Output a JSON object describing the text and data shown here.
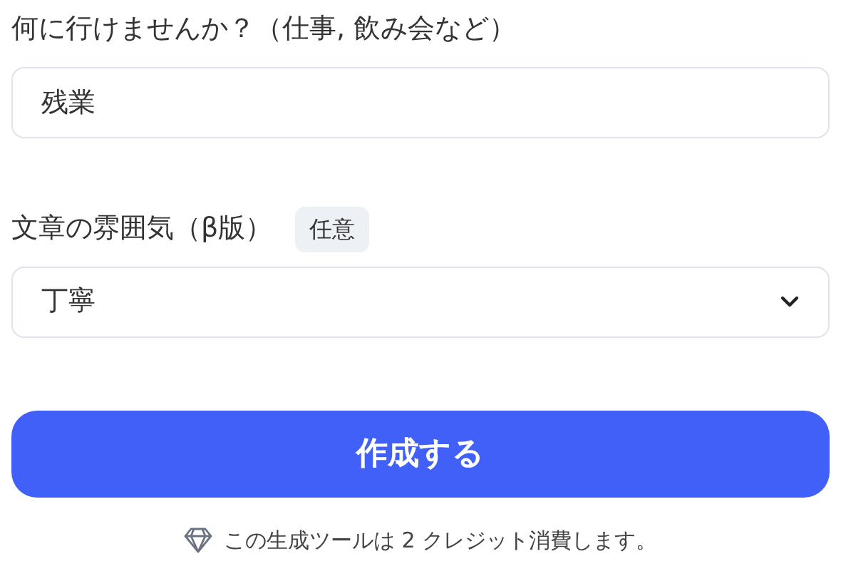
{
  "fields": [
    {
      "kind": "text",
      "label": "何に行けませんか？（仕事, 飲み会など）",
      "value": "残業"
    },
    {
      "kind": "select",
      "label": "文章の雰囲気（β版）",
      "badge": "任意",
      "value": "丁寧"
    }
  ],
  "submit": {
    "label": "作成する"
  },
  "note": "この生成ツールは 2 クレジット消費します。"
}
